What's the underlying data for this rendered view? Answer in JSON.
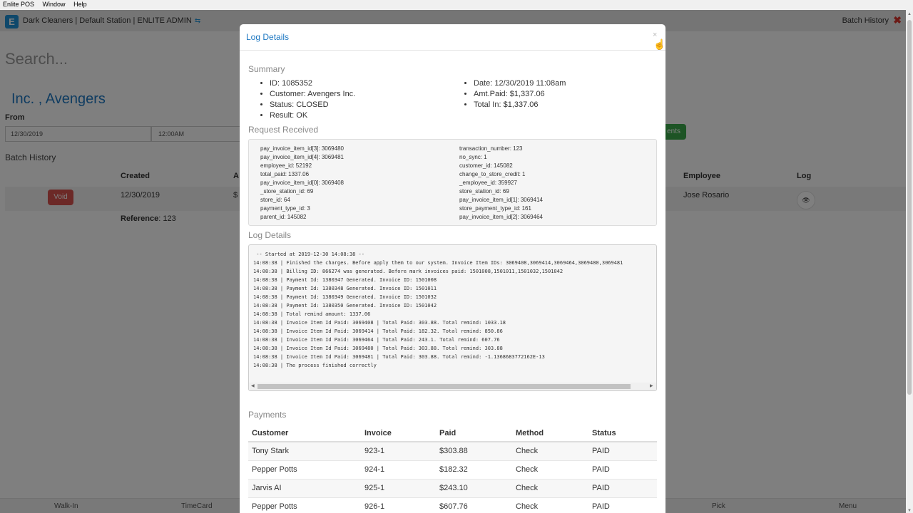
{
  "menubar": [
    "Enlite POS",
    "Window",
    "Help"
  ],
  "app": {
    "station_title": "Dark Cleaners | Default Station | ENLITE ADMIN",
    "batch_history_link": "Batch History",
    "search_placeholder": "Search...",
    "customer_name": "Inc. , Avengers",
    "from_label": "From",
    "from_date": "12/30/2019",
    "from_time": "12:00AM",
    "green_button_label": "ents",
    "batch_title": "Batch History",
    "columns": {
      "created": "Created",
      "a": "A",
      "employee": "Employee",
      "log": "Log"
    },
    "row": {
      "void_label": "Void",
      "created": "12/30/2019",
      "amount": "$",
      "employee": "Jose Rosario"
    },
    "reference_label": "Reference",
    "reference_value": "123"
  },
  "footer": [
    "Walk-In",
    "TimeCard",
    "Pick",
    "Menu"
  ],
  "modal": {
    "title": "Log Details",
    "close": "×",
    "summary_title": "Summary",
    "summary_left": [
      "ID: 1085352",
      "Customer: Avengers Inc.",
      "Status: CLOSED",
      "Result: OK"
    ],
    "summary_right": [
      "Date: 12/30/2019 11:08am",
      "Amt.Paid: $1,337.06",
      "Total In: $1,337.06"
    ],
    "request_title": "Request Received",
    "request_left": [
      "pay_invoice_item_id[3]: 3069480",
      "pay_invoice_item_id[4]: 3069481",
      "employee_id: 52192",
      "total_paid: 1337.06",
      "pay_invoice_item_id[0]: 3069408",
      "_store_station_id: 69",
      "store_id: 64",
      "payment_type_id: 3",
      "parent_id: 145082"
    ],
    "request_right": [
      "transaction_number: 123",
      "no_sync: 1",
      "customer_id: 145082",
      "change_to_store_credit: 1",
      "_employee_id: 359927",
      "store_station_id: 69",
      "pay_invoice_item_id[1]: 3069414",
      "store_payment_type_id: 161",
      "pay_invoice_item_id[2]: 3069464"
    ],
    "log_title": "Log Details",
    "log_lines": [
      " -- Started at 2019-12-30 14:08:38 --",
      "14:08:38 | Finished the charges. Before apply them to our system. Invoice Item IDs: 3069408,3069414,3069464,3069480,3069481",
      "14:08:38 | Billing ID: 866274 was generated. Before mark invoices paid: 1501008,1501011,1501032,1501042",
      "14:08:38 | Payment Id: 1380347 Generated. Invoice ID: 1501008",
      "14:08:38 | Payment Id: 1380348 Generated. Invoice ID: 1501011",
      "14:08:38 | Payment Id: 1380349 Generated. Invoice ID: 1501032",
      "14:08:38 | Payment Id: 1380350 Generated. Invoice ID: 1501042",
      "14:08:38 | Total remind amount: 1337.06",
      "14:08:38 | Invoice Item Id Paid: 3069408 | Total Paid: 303.88. Total remind: 1033.18",
      "14:08:38 | Invoice Item Id Paid: 3069414 | Total Paid: 182.32. Total remind: 850.86",
      "14:08:38 | Invoice Item Id Paid: 3069464 | Total Paid: 243.1. Total remind: 607.76",
      "14:08:38 | Invoice Item Id Paid: 3069480 | Total Paid: 303.88. Total remind: 303.88",
      "14:08:38 | Invoice Item Id Paid: 3069481 | Total Paid: 303.88. Total remind: -1.1368683772162E-13",
      "14:08:38 | The process finished correctly"
    ],
    "payments_title": "Payments",
    "payments_headers": [
      "Customer",
      "Invoice",
      "Paid",
      "Method",
      "Status"
    ],
    "payments_rows": [
      [
        "Tony Stark",
        "923-1",
        "$303.88",
        "Check",
        "PAID"
      ],
      [
        "Pepper Potts",
        "924-1",
        "$182.32",
        "Check",
        "PAID"
      ],
      [
        "Jarvis AI",
        "925-1",
        "$243.10",
        "Check",
        "PAID"
      ],
      [
        "Pepper Potts",
        "926-1",
        "$607.76",
        "Check",
        "PAID"
      ]
    ]
  },
  "colors": {
    "accent": "#1e78c2",
    "void": "#d9534f",
    "confirm": "#3aa94a",
    "close": "#d9322a"
  }
}
